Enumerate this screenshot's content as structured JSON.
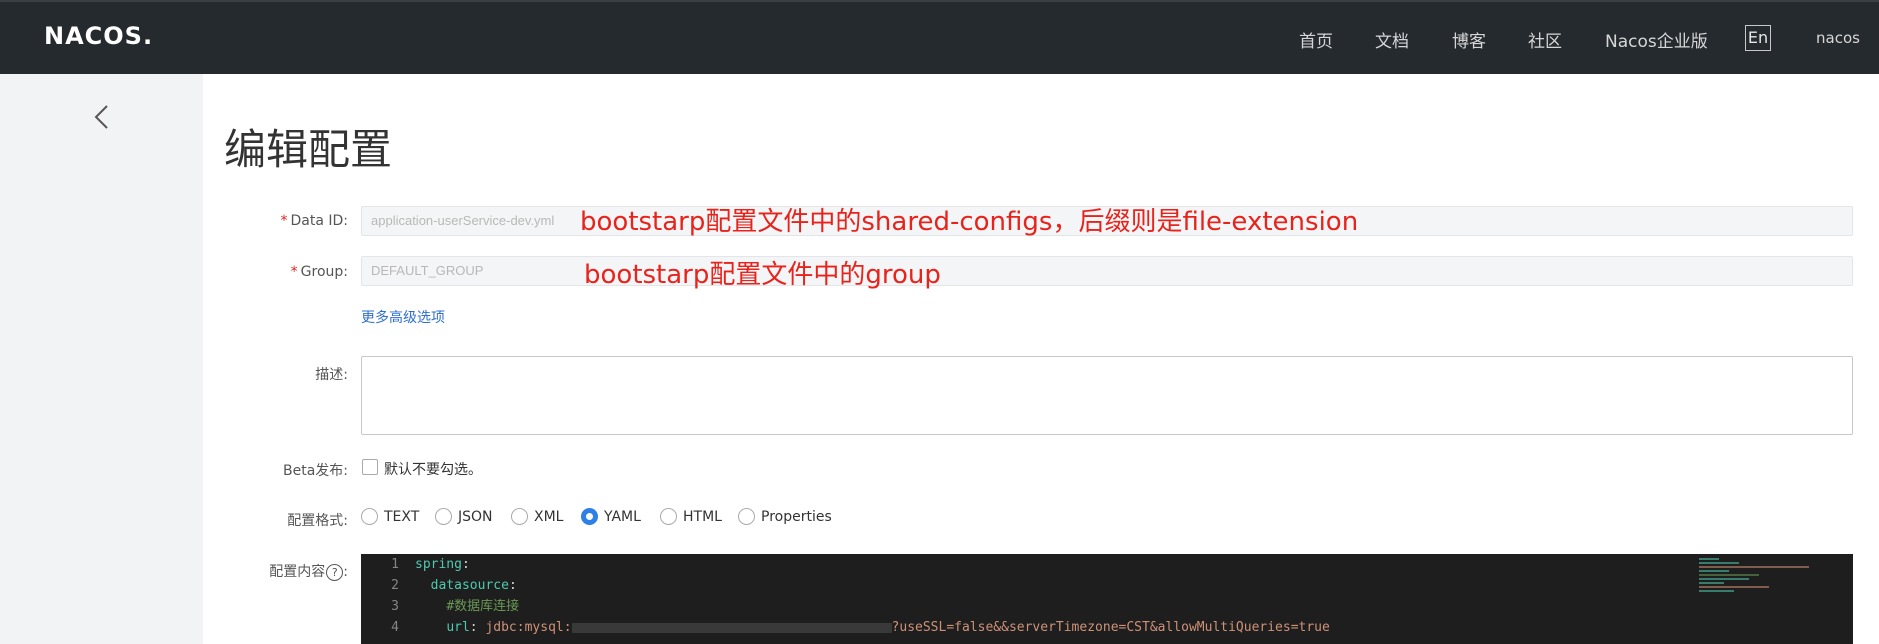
{
  "header": {
    "logo": "NACOS.",
    "nav": [
      "首页",
      "文档",
      "博客",
      "社区",
      "Nacos企业版"
    ],
    "lang": "En",
    "user": "nacos"
  },
  "page": {
    "title": "编辑配置"
  },
  "form": {
    "data_id_label": "Data ID:",
    "data_id_value": "application-userService-dev.yml",
    "data_id_annotation": "bootstarp配置文件中的shared-configs，后缀则是file-extension",
    "group_label": "Group:",
    "group_value": "DEFAULT_GROUP",
    "group_annotation": "bootstarp配置文件中的group",
    "advanced_link": "更多高级选项",
    "desc_label": "描述:",
    "beta_label": "Beta发布:",
    "beta_text": "默认不要勾选。",
    "format_label": "配置格式:",
    "formats": [
      "TEXT",
      "JSON",
      "XML",
      "YAML",
      "HTML",
      "Properties"
    ],
    "selected_format": "YAML",
    "content_label": "配置内容",
    "content_label_suffix": ":"
  },
  "editor": {
    "line_numbers": [
      "1",
      "2",
      "3",
      "4"
    ],
    "line1_key": "spring",
    "line2_key": "datasource",
    "line3_comment": "#数据库连接",
    "line4_key": "url",
    "line4_value_prefix": "jdbc:mysql:",
    "line4_value_suffix": "?useSSL=false&&serverTimezone=CST&allowMultiQueries=true"
  },
  "colors": {
    "topbar": "#252a2f",
    "accent": "#2f7fe8",
    "annotation": "#e8231c",
    "editor_bg": "#1e1e1e"
  }
}
